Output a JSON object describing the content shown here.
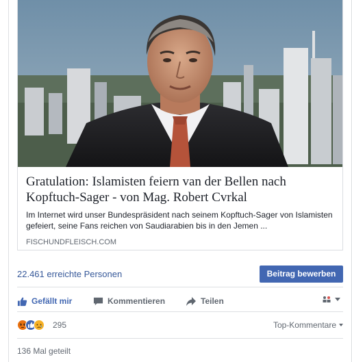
{
  "link_card": {
    "title": "Gratulation: Islamisten feiern van der Bellen nach Kopftuch-Sager - von Mag. Robert Cvrkal",
    "description": "Im Internet wird unser Bundespräsident nach seinem Kopftuch-Sager von Islamisten gefeiert, seine Fans reichen von Saudiarabien bis in den Jemen ...",
    "domain": "FISCHUNDFLEISCH.COM",
    "image_icon": "portrait-photo"
  },
  "reach": {
    "text": "22.461 erreichte Personen",
    "boost_label": "Beitrag bewerben"
  },
  "actions": {
    "like_label": "Gefällt mir",
    "comment_label": "Kommentieren",
    "share_label": "Teilen",
    "audience_icon": "audience-selector-icon"
  },
  "reactions": {
    "count": "295",
    "icons": [
      "angry-icon",
      "like-icon",
      "sad-icon"
    ],
    "sort_label": "Top-Kommentare"
  },
  "shares": {
    "text": "136 Mal geteilt"
  },
  "colors": {
    "link_blue": "#365899",
    "button_blue": "#4267b2",
    "muted": "#606770",
    "border": "#dddfe2"
  }
}
